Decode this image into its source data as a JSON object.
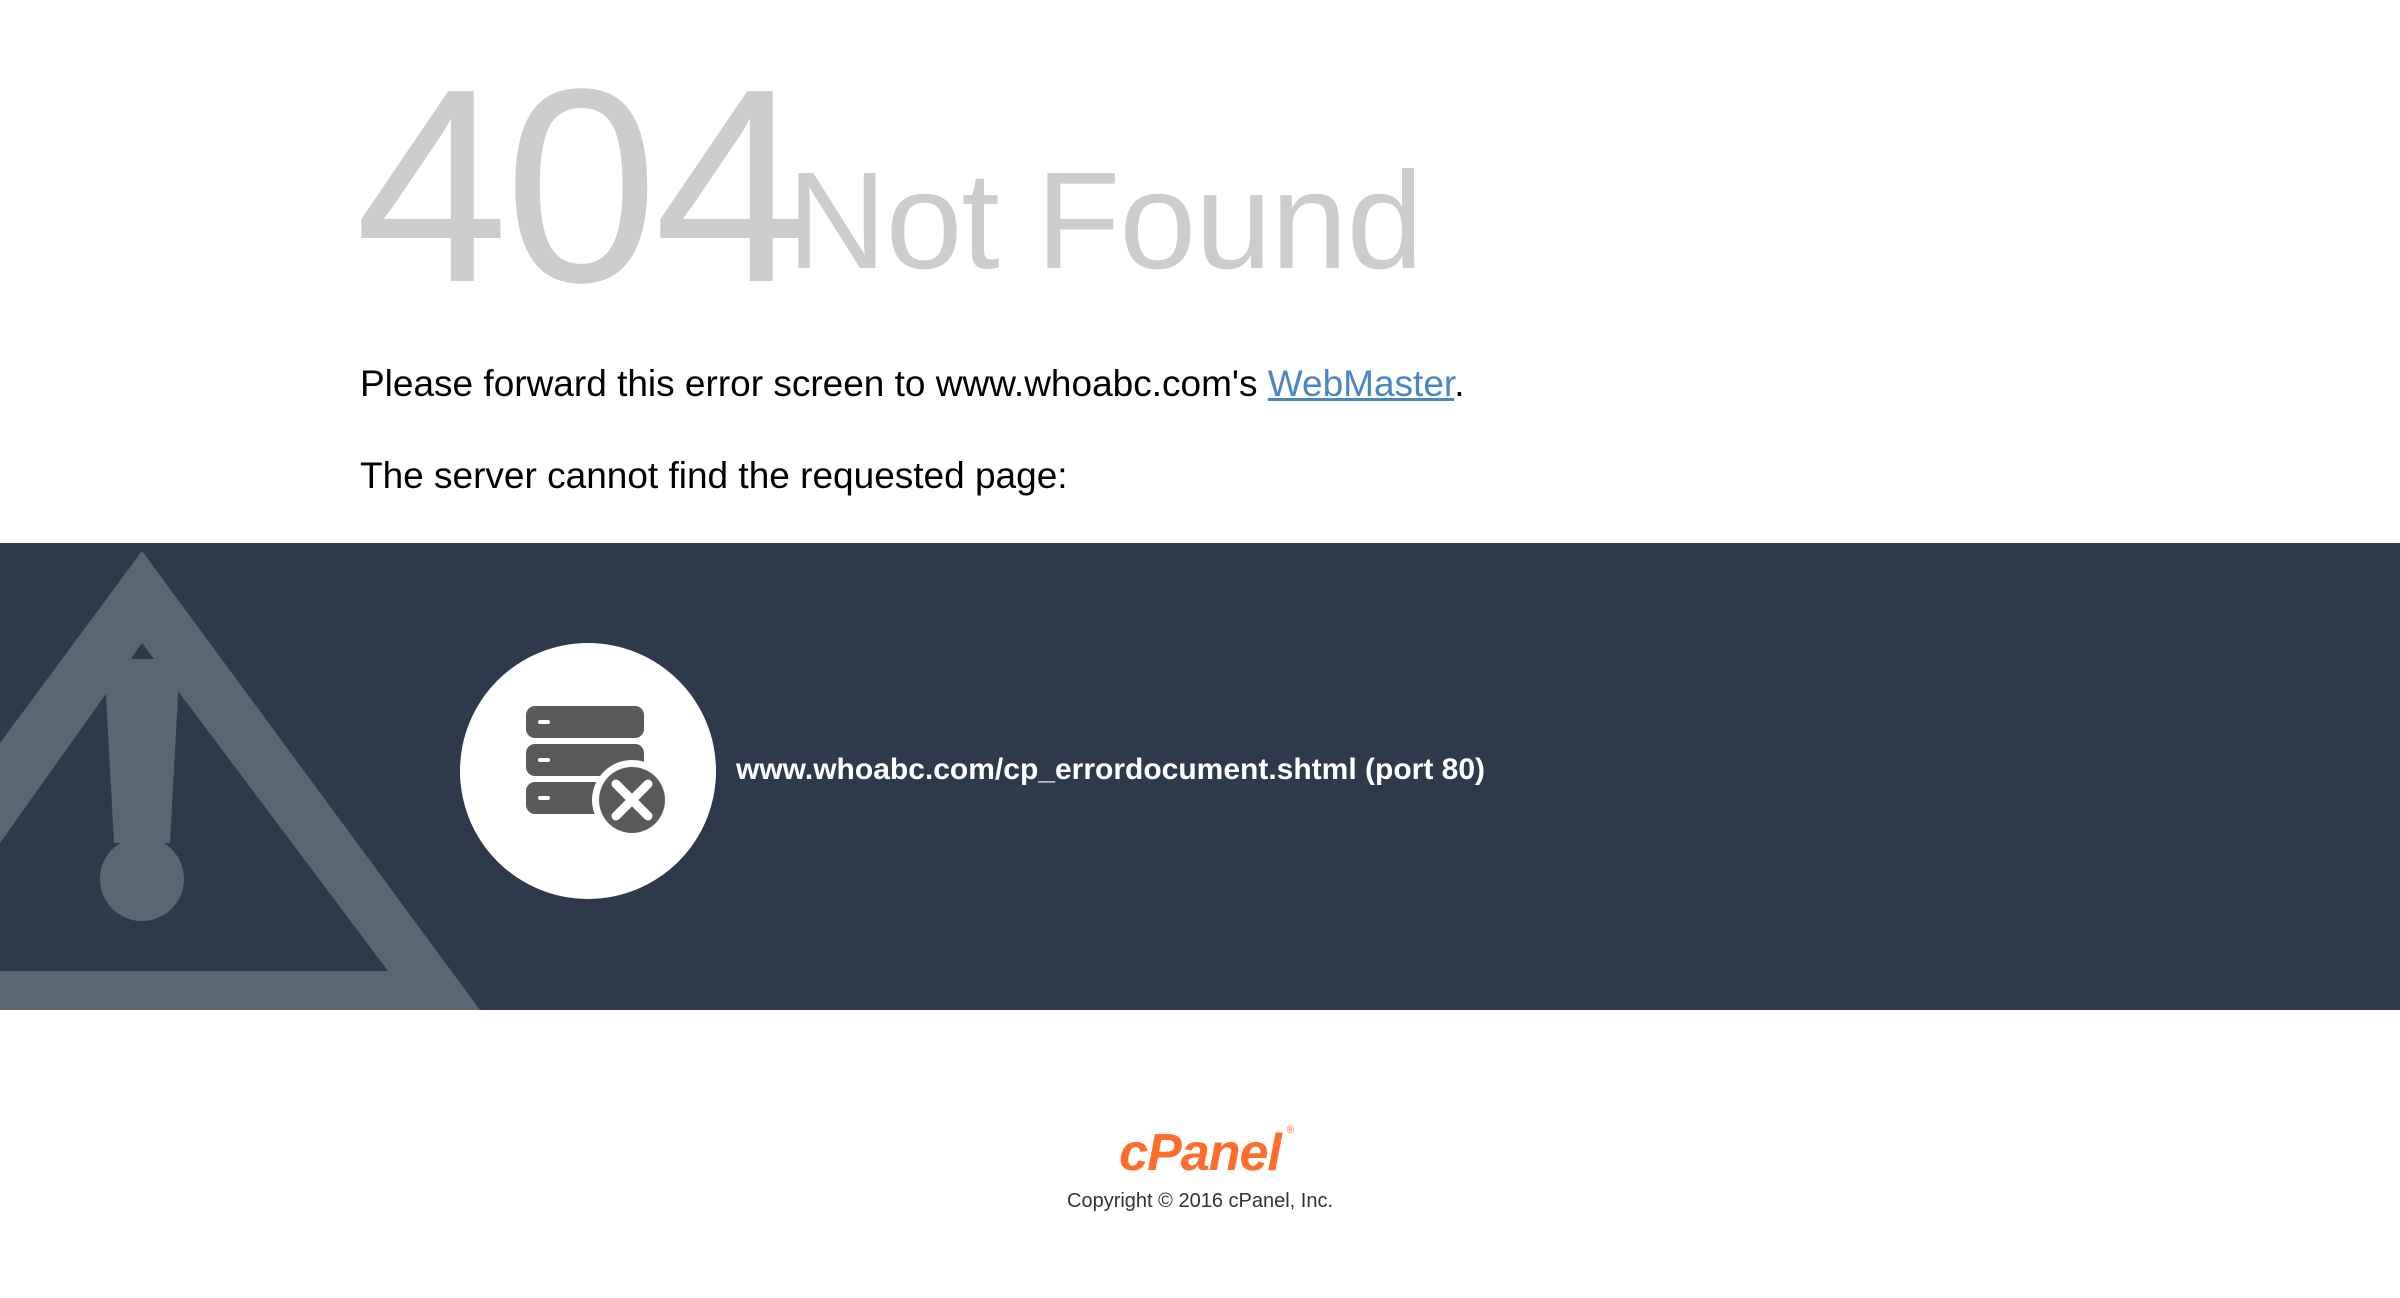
{
  "heading": {
    "code": "404",
    "title": "Not Found"
  },
  "message": {
    "forward_prefix": "Please forward this error screen to www.whoabc.com's ",
    "webmaster_link": "WebMaster",
    "forward_suffix": ".",
    "server_text": "The server cannot find the requested page:"
  },
  "error_band": {
    "url": "www.whoabc.com/cp_errordocument.shtml (port 80)"
  },
  "footer": {
    "logo": "cPanel",
    "logo_registered": "®",
    "copyright": "Copyright © 2016 cPanel, Inc."
  },
  "colors": {
    "band_background": "#2e3a4b",
    "heading_gray": "#cccccc",
    "link_blue": "#4a86c5",
    "brand_orange": "#ff6c2c"
  },
  "icons": {
    "warning": "warning-triangle-icon",
    "server_error": "server-error-icon"
  }
}
